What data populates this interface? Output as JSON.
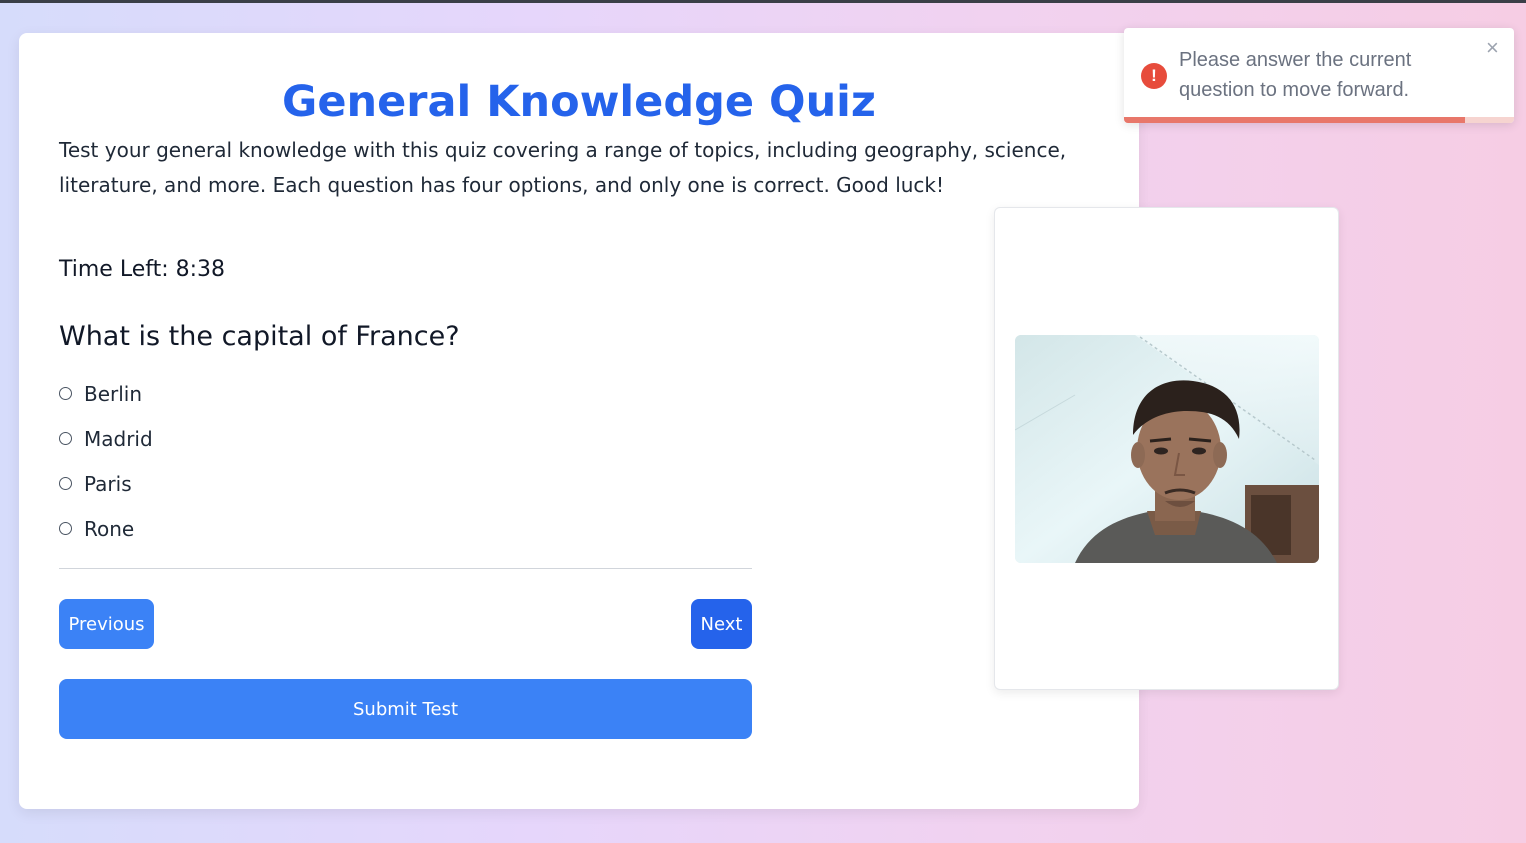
{
  "quiz": {
    "title": "General Knowledge Quiz",
    "description": "Test your general knowledge with this quiz covering a range of topics, including geography, science, literature, and more. Each question has four options, and only one is correct. Good luck!",
    "timer_label": "Time Left: 8:38",
    "question": "What is the capital of France?",
    "options": [
      "Berlin",
      "Madrid",
      "Paris",
      "Rone"
    ],
    "selected_option": null
  },
  "navigation": {
    "previous_label": "Previous",
    "next_label": "Next",
    "submit_label": "Submit Test"
  },
  "webcam": {
    "status": "live"
  },
  "toast": {
    "message": "Please answer the current question to move forward.",
    "icon": "error-icon",
    "close_icon": "close-icon",
    "close_glyph": "×",
    "progress_fraction": 0.875,
    "color": "#e74c3c"
  },
  "colors": {
    "accent": "#2563eb",
    "button": "#3b82f6",
    "error": "#e74c3c"
  }
}
